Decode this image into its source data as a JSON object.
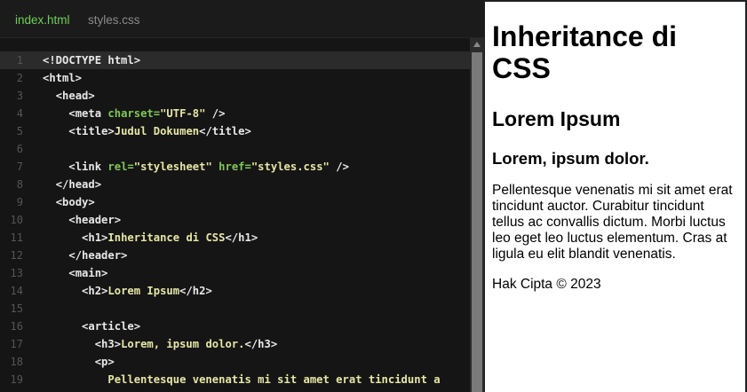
{
  "tabs": [
    {
      "label": "index.html",
      "active": true
    },
    {
      "label": "styles.css",
      "active": false
    }
  ],
  "code_lines": [
    {
      "num": "1",
      "indent": "",
      "tokens": [
        [
          "t",
          "<!DOCTYPE html>"
        ]
      ],
      "highlight": true
    },
    {
      "num": "2",
      "indent": "",
      "tokens": [
        [
          "t",
          "<html>"
        ]
      ]
    },
    {
      "num": "3",
      "indent": "  ",
      "tokens": [
        [
          "t",
          "<head>"
        ]
      ]
    },
    {
      "num": "4",
      "indent": "    ",
      "tokens": [
        [
          "t",
          "<meta "
        ],
        [
          "a",
          "charset="
        ],
        [
          "s",
          "\"UTF-8\""
        ],
        [
          "t",
          " />"
        ]
      ]
    },
    {
      "num": "5",
      "indent": "    ",
      "tokens": [
        [
          "t",
          "<title>"
        ],
        [
          "x",
          "Judul Dokumen"
        ],
        [
          "t",
          "</title>"
        ]
      ]
    },
    {
      "num": "6",
      "indent": "",
      "tokens": []
    },
    {
      "num": "7",
      "indent": "    ",
      "tokens": [
        [
          "t",
          "<link "
        ],
        [
          "a",
          "rel="
        ],
        [
          "s",
          "\"stylesheet\""
        ],
        [
          "t",
          " "
        ],
        [
          "a",
          "href="
        ],
        [
          "s",
          "\"styles.css\""
        ],
        [
          "t",
          " />"
        ]
      ]
    },
    {
      "num": "8",
      "indent": "  ",
      "tokens": [
        [
          "t",
          "</head>"
        ]
      ]
    },
    {
      "num": "9",
      "indent": "  ",
      "tokens": [
        [
          "t",
          "<body>"
        ]
      ]
    },
    {
      "num": "10",
      "indent": "    ",
      "tokens": [
        [
          "t",
          "<header>"
        ]
      ]
    },
    {
      "num": "11",
      "indent": "      ",
      "tokens": [
        [
          "t",
          "<h1>"
        ],
        [
          "x",
          "Inheritance di CSS"
        ],
        [
          "t",
          "</h1>"
        ]
      ]
    },
    {
      "num": "12",
      "indent": "    ",
      "tokens": [
        [
          "t",
          "</header>"
        ]
      ]
    },
    {
      "num": "13",
      "indent": "    ",
      "tokens": [
        [
          "t",
          "<main>"
        ]
      ]
    },
    {
      "num": "14",
      "indent": "      ",
      "tokens": [
        [
          "t",
          "<h2>"
        ],
        [
          "x",
          "Lorem Ipsum"
        ],
        [
          "t",
          "</h2>"
        ]
      ]
    },
    {
      "num": "15",
      "indent": "",
      "tokens": []
    },
    {
      "num": "16",
      "indent": "      ",
      "tokens": [
        [
          "t",
          "<article>"
        ]
      ]
    },
    {
      "num": "17",
      "indent": "        ",
      "tokens": [
        [
          "t",
          "<h3>"
        ],
        [
          "x",
          "Lorem, ipsum dolor."
        ],
        [
          "t",
          "</h3>"
        ]
      ]
    },
    {
      "num": "18",
      "indent": "        ",
      "tokens": [
        [
          "t",
          "<p>"
        ]
      ]
    },
    {
      "num": "19",
      "indent": "          ",
      "tokens": [
        [
          "x",
          "Pellentesque venenatis mi sit amet erat tincidunt a"
        ]
      ]
    }
  ],
  "preview": {
    "h1": "Inheritance di CSS",
    "h2": "Lorem Ipsum",
    "h3": "Lorem, ipsum dolor.",
    "paragraph": "Pellentesque venenatis mi sit amet erat tincidunt auctor. Curabitur tincidunt tellus ac convallis dictum. Morbi luctus leo eget leo luctus elementum. Cras at ligula eu elit blandit venenatis.",
    "footer": "Hak Cipta © 2023"
  },
  "colors": {
    "editor_bg": "#151515",
    "active_tab": "#6fcf57",
    "attribute": "#7fc857",
    "string": "#e6e6a6",
    "tag": "#e8e8e8"
  }
}
